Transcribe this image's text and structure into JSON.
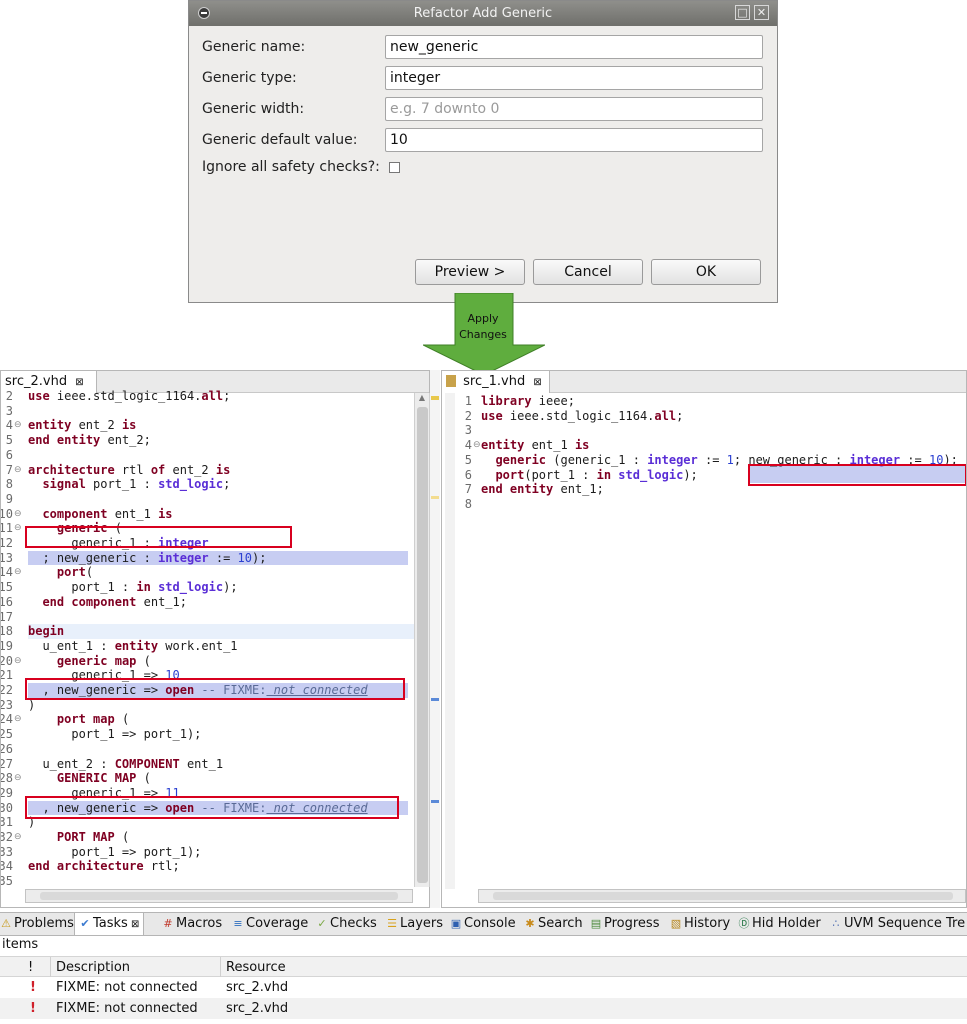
{
  "dialog": {
    "title": "Refactor Add Generic",
    "fields": {
      "name_label": "Generic name:",
      "name_value": "new_generic",
      "type_label": "Generic type:",
      "type_value": "integer",
      "width_label": "Generic width:",
      "width_placeholder": "e.g. 7 downto 0",
      "default_label": "Generic default value:",
      "default_value": "10",
      "ignore_label": "Ignore all safety checks?:"
    },
    "buttons": {
      "preview": "Preview >",
      "cancel": "Cancel",
      "ok": "OK"
    }
  },
  "arrow": {
    "line1": "Apply",
    "line2": "Changes"
  },
  "left_editor": {
    "tab": "src_2.vhd",
    "lines": [
      {
        "n": "2",
        "t": "use ieee.std_logic_1164.all;"
      },
      {
        "n": "3",
        "t": ""
      },
      {
        "n": "4",
        "t": "entity ent_2 is"
      },
      {
        "n": "5",
        "t": "end entity ent_2;"
      },
      {
        "n": "6",
        "t": ""
      },
      {
        "n": "7",
        "t": "architecture rtl of ent_2 is"
      },
      {
        "n": "8",
        "t": "  signal port_1 : std_logic;"
      },
      {
        "n": "9",
        "t": ""
      },
      {
        "n": "10",
        "t": "  component ent_1 is"
      },
      {
        "n": "11",
        "t": "    generic ("
      },
      {
        "n": "12",
        "t": "      generic_1 : integer"
      },
      {
        "n": "13",
        "t": "  ; new_generic : integer := 10);"
      },
      {
        "n": "14",
        "t": "    port("
      },
      {
        "n": "15",
        "t": "      port_1 : in std_logic);"
      },
      {
        "n": "16",
        "t": "  end component ent_1;"
      },
      {
        "n": "17",
        "t": ""
      },
      {
        "n": "18",
        "t": "begin"
      },
      {
        "n": "19",
        "t": "  u_ent_1 : entity work.ent_1"
      },
      {
        "n": "20",
        "t": "    generic map ("
      },
      {
        "n": "21",
        "t": "      generic_1 => 10"
      },
      {
        "n": "22",
        "t": "  , new_generic => open -- FIXME: not connected"
      },
      {
        "n": "23",
        "t": ")"
      },
      {
        "n": "24",
        "t": "    port map ("
      },
      {
        "n": "25",
        "t": "      port_1 => port_1);"
      },
      {
        "n": "26",
        "t": ""
      },
      {
        "n": "27",
        "t": "  u_ent_2 : COMPONENT ent_1"
      },
      {
        "n": "28",
        "t": "    GENERIC MAP ("
      },
      {
        "n": "29",
        "t": "      generic_1 => 11"
      },
      {
        "n": "30",
        "t": "  , new_generic => open -- FIXME: not connected"
      },
      {
        "n": "31",
        "t": ")"
      },
      {
        "n": "32",
        "t": "    PORT MAP ("
      },
      {
        "n": "33",
        "t": "      port_1 => port_1);"
      },
      {
        "n": "34",
        "t": "end architecture rtl;"
      },
      {
        "n": "35",
        "t": ""
      }
    ]
  },
  "right_editor": {
    "tab": "src_1.vhd",
    "lines": [
      {
        "n": "1",
        "t": "library ieee;"
      },
      {
        "n": "2",
        "t": "use ieee.std_logic_1164.all;"
      },
      {
        "n": "3",
        "t": ""
      },
      {
        "n": "4",
        "t": "entity ent_1 is"
      },
      {
        "n": "5",
        "t": "  generic (generic_1 : integer := 1; new_generic : integer := 10);"
      },
      {
        "n": "6",
        "t": "  port(port_1 : in std_logic);"
      },
      {
        "n": "7",
        "t": "end entity ent_1;"
      },
      {
        "n": "8",
        "t": ""
      }
    ]
  },
  "bottom": {
    "tabs": [
      "Problems",
      "Tasks",
      "Macros",
      "Coverage",
      "Checks",
      "Layers",
      "Console",
      "Search",
      "Progress",
      "History",
      "Hid Holder",
      "UVM Sequence Tre"
    ],
    "items_label": "items",
    "columns": [
      "!",
      "Description",
      "Resource"
    ],
    "rows": [
      {
        "desc": "FIXME: not connected",
        "res": "src_2.vhd"
      },
      {
        "desc": "FIXME: not connected",
        "res": "src_2.vhd"
      }
    ]
  }
}
